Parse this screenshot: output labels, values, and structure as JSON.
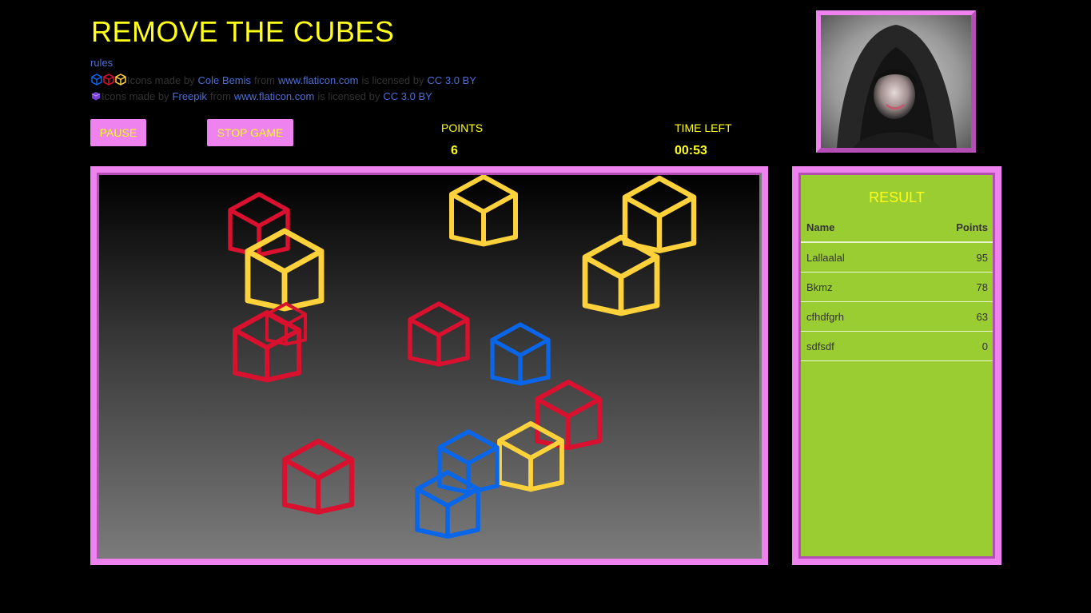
{
  "title": "REMOVE THE CUBES",
  "rules_link": "rules",
  "credits": [
    {
      "icons_text": "Icons made by",
      "author": "Cole Bemis",
      "from_text": "from",
      "site": "www.flaticon.com",
      "licensed_text": "is licensed by",
      "license": "CC 3.0 BY"
    },
    {
      "icons_text": "Icons made by",
      "author": "Freepik",
      "from_text": "from",
      "site": "www.flaticon.com",
      "licensed_text": "is licensed by",
      "license": "CC 3.0 BY"
    }
  ],
  "controls": {
    "pause_label": "PAUSE",
    "stop_label": "STOP GAME"
  },
  "stats": {
    "points_label": "POINTS",
    "points_value": "6",
    "time_label": "TIME LEFT",
    "time_value": "00:53"
  },
  "colors": {
    "red": "#d9102e",
    "yellow": "#ffd23c",
    "blue": "#0a66e8",
    "accent": "#ee82ee",
    "title": "#ffff1a",
    "panel": "#9acd32"
  },
  "result": {
    "title": "RESULT",
    "headers": {
      "name": "Name",
      "points": "Points"
    },
    "rows": [
      {
        "name": "Lallaalal",
        "points": "95"
      },
      {
        "name": "Bkmz",
        "points": "78"
      },
      {
        "name": "cfhdfgrh",
        "points": "63"
      },
      {
        "name": "sdfsdf",
        "points": "0"
      }
    ]
  },
  "cubes": [
    {
      "color": "red"
    },
    {
      "color": "yellow"
    },
    {
      "color": "red"
    },
    {
      "color": "red"
    },
    {
      "color": "yellow"
    },
    {
      "color": "yellow"
    },
    {
      "color": "yellow"
    },
    {
      "color": "red"
    },
    {
      "color": "blue"
    },
    {
      "color": "red"
    },
    {
      "color": "yellow"
    },
    {
      "color": "red"
    },
    {
      "color": "blue"
    },
    {
      "color": "blue"
    }
  ]
}
